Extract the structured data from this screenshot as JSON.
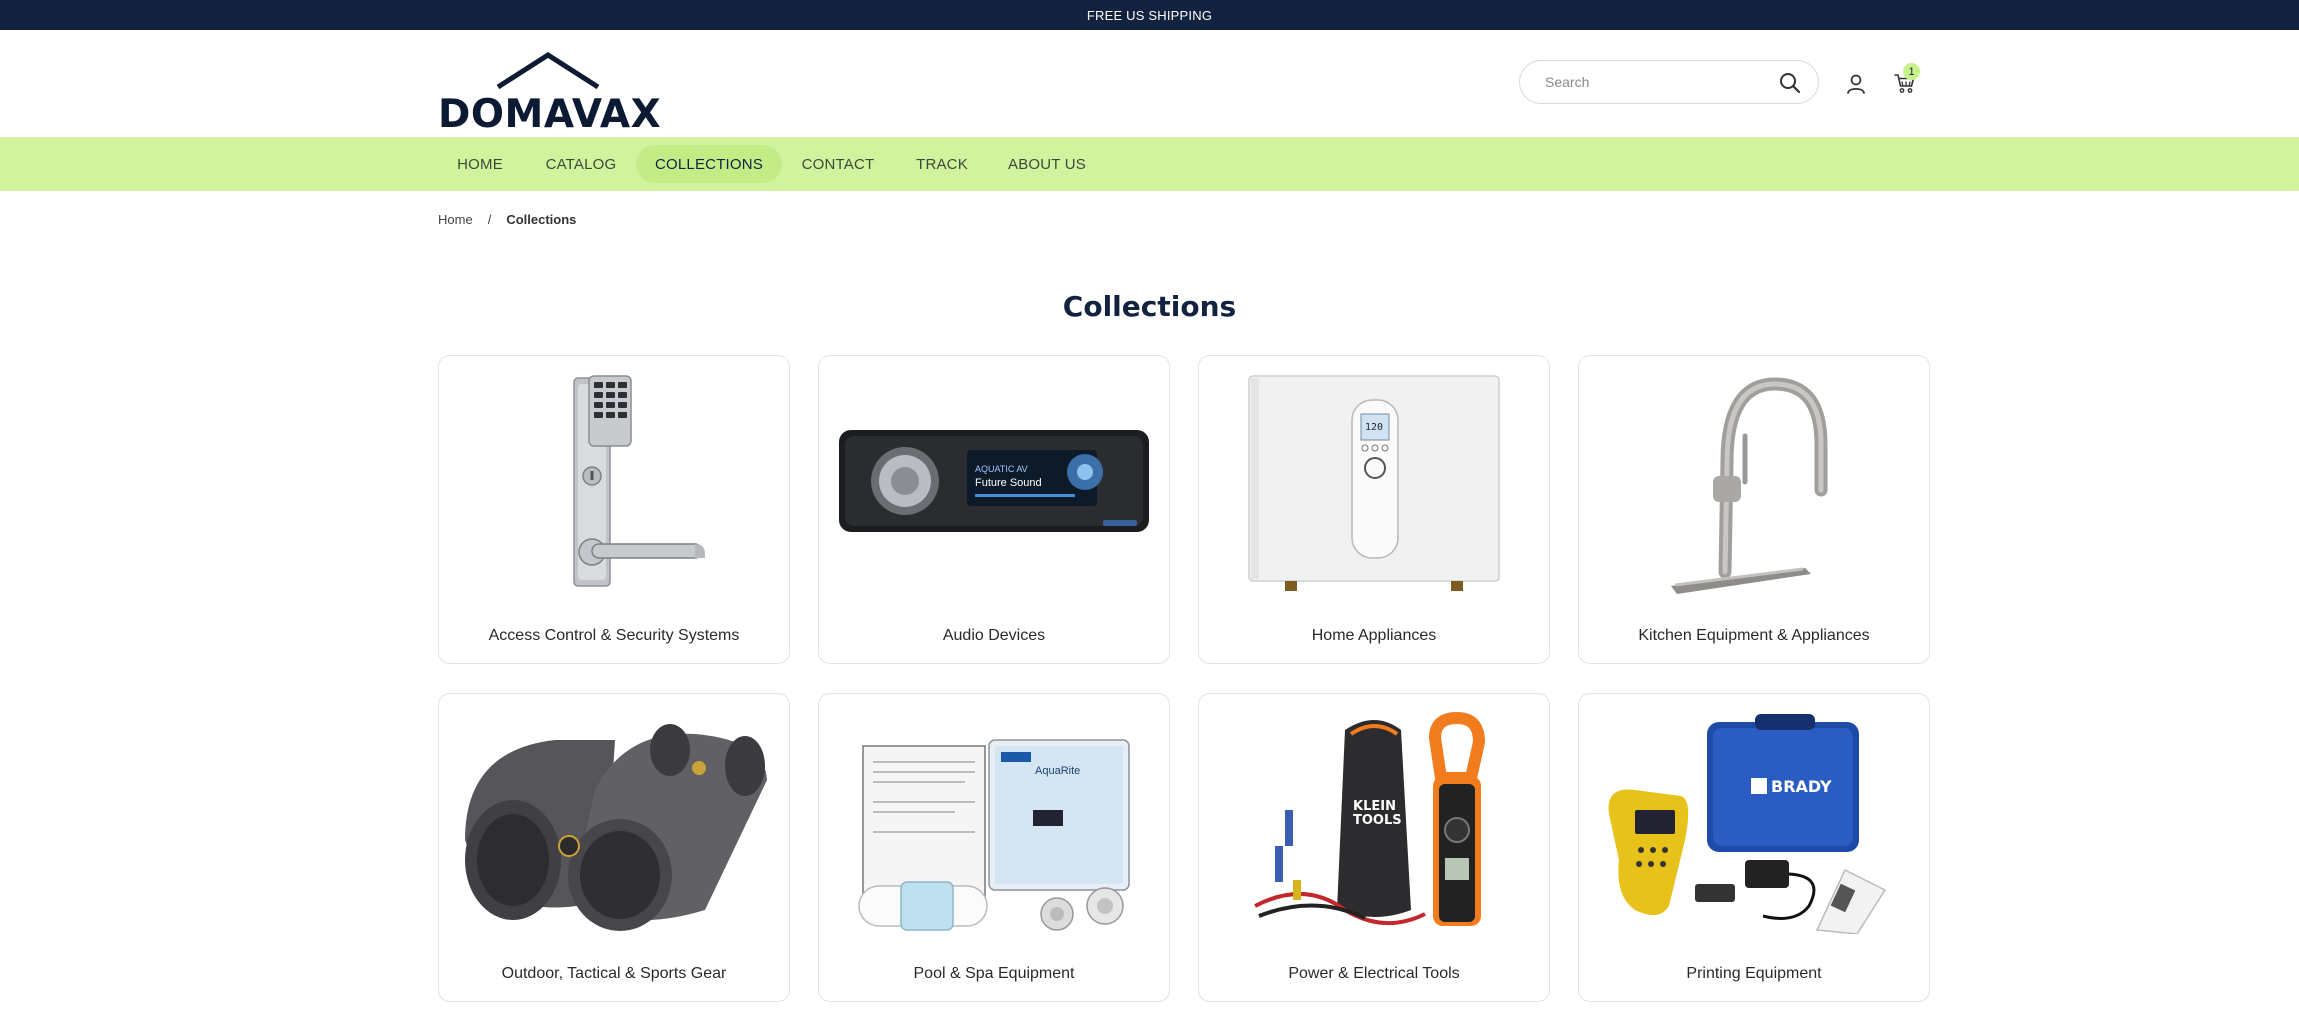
{
  "announcement": "FREE US SHIPPING",
  "brand": {
    "name": "DOMAVAX"
  },
  "search": {
    "placeholder": "Search",
    "value": ""
  },
  "cart": {
    "count": "1"
  },
  "colors": {
    "topbar": "#12223f",
    "nav_bg": "#d2f39d",
    "nav_active": "#c4ec86",
    "badge": "#c8f28a"
  },
  "nav": {
    "items": [
      {
        "label": "HOME",
        "active": false
      },
      {
        "label": "CATALOG",
        "active": false
      },
      {
        "label": "COLLECTIONS",
        "active": true
      },
      {
        "label": "CONTACT",
        "active": false
      },
      {
        "label": "TRACK",
        "active": false
      },
      {
        "label": "ABOUT US",
        "active": false
      }
    ]
  },
  "breadcrumb": {
    "home": "Home",
    "separator": "/",
    "current": "Collections"
  },
  "page": {
    "title": "Collections"
  },
  "collections": [
    {
      "label": "Access Control & Security Systems",
      "icon": "keypad-lock-icon"
    },
    {
      "label": "Audio Devices",
      "icon": "car-stereo-icon"
    },
    {
      "label": "Home Appliances",
      "icon": "water-heater-icon"
    },
    {
      "label": "Kitchen Equipment & Appliances",
      "icon": "faucet-icon"
    },
    {
      "label": "Outdoor, Tactical & Sports Gear",
      "icon": "binoculars-icon"
    },
    {
      "label": "Pool & Spa Equipment",
      "icon": "pool-chlorinator-icon"
    },
    {
      "label": "Power & Electrical Tools",
      "icon": "clamp-meter-icon"
    },
    {
      "label": "Printing Equipment",
      "icon": "label-printer-icon"
    }
  ]
}
